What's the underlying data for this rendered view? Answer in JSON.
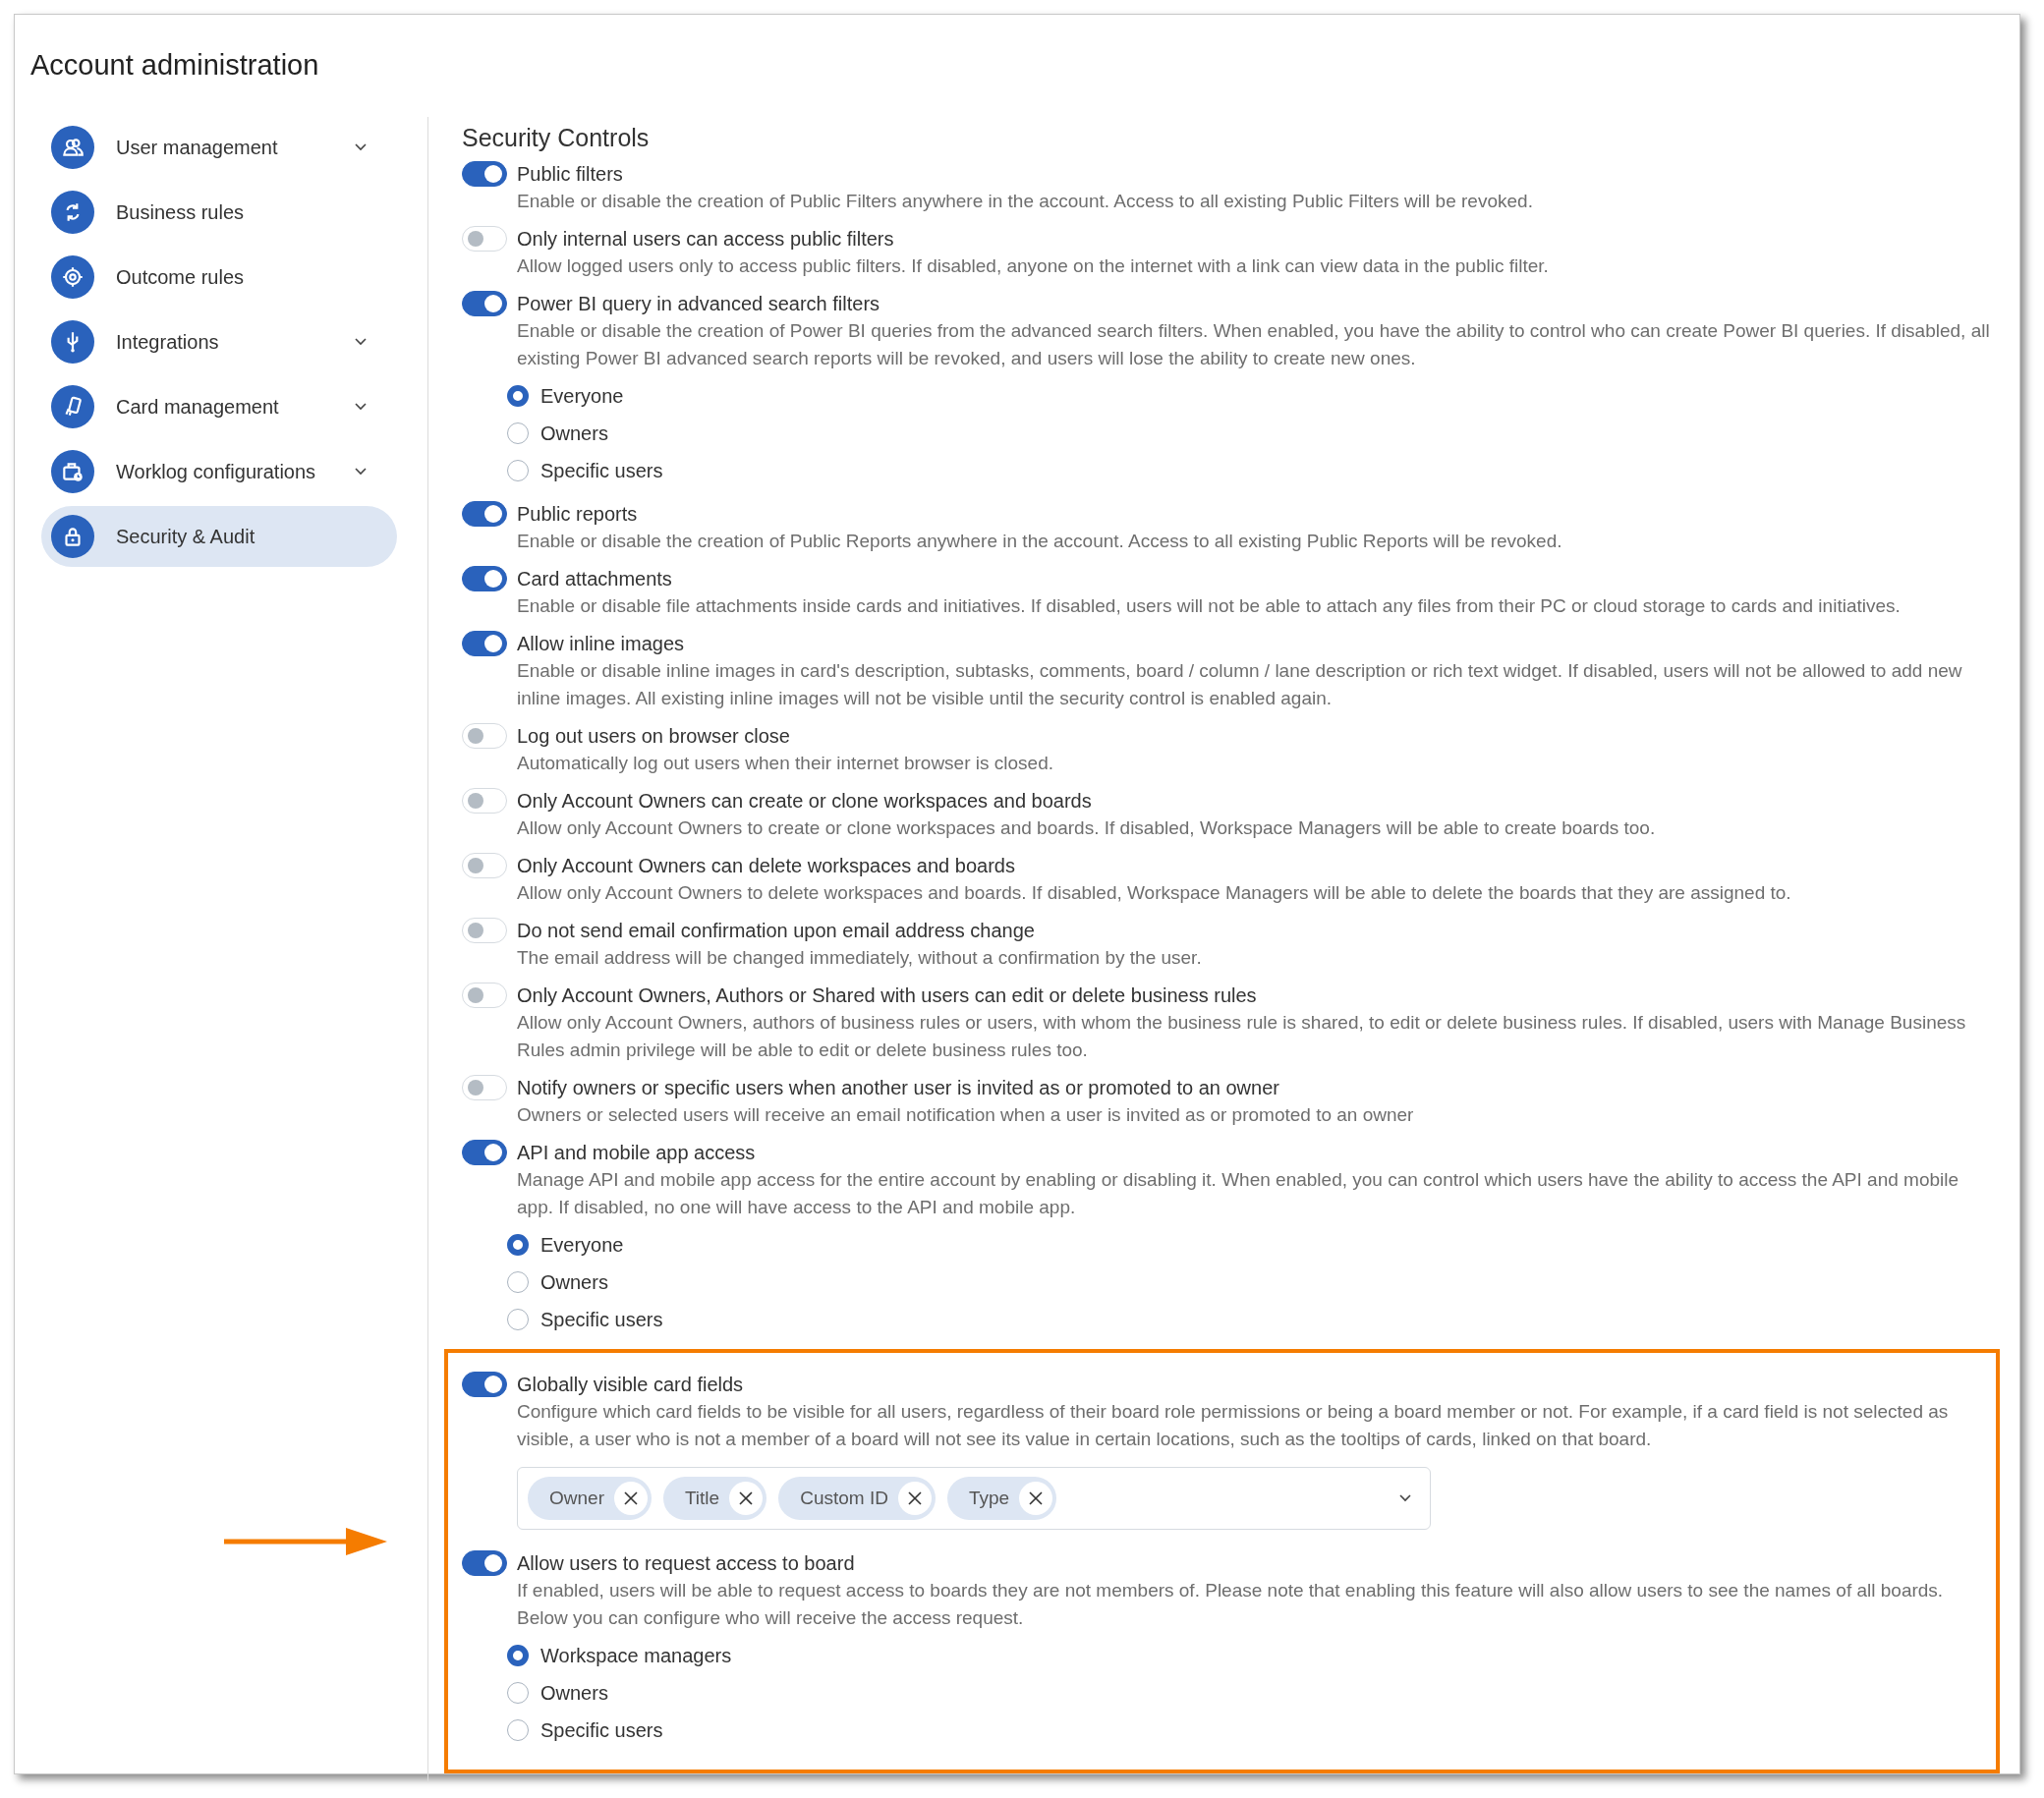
{
  "window": {
    "title": "Account administration"
  },
  "sidebar": {
    "items": [
      {
        "label": "User management",
        "expandable": true,
        "selected": false
      },
      {
        "label": "Business rules",
        "expandable": false,
        "selected": false
      },
      {
        "label": "Outcome rules",
        "expandable": false,
        "selected": false
      },
      {
        "label": "Integrations",
        "expandable": true,
        "selected": false
      },
      {
        "label": "Card management",
        "expandable": true,
        "selected": false
      },
      {
        "label": "Worklog configurations",
        "expandable": true,
        "selected": false
      },
      {
        "label": "Security & Audit",
        "expandable": false,
        "selected": true
      }
    ]
  },
  "content": {
    "heading": "Security Controls",
    "settings": [
      {
        "title": "Public filters",
        "on": true,
        "highlighted": false,
        "description": "Enable or disable the creation of Public Filters anywhere in the account. Access to all existing Public Filters will be revoked."
      },
      {
        "title": "Only internal users can access public filters",
        "on": false,
        "highlighted": false,
        "description": "Allow logged users only to access public filters. If disabled, anyone on the internet with a link can view data in the public filter."
      },
      {
        "title": "Power BI query in advanced search filters",
        "on": true,
        "highlighted": false,
        "description": "Enable or disable the creation of Power BI queries from the advanced search filters. When enabled, you have the ability to control who can create Power BI queries. If disabled, all existing Power BI advanced search reports will be revoked, and users will lose the ability to create new ones.",
        "options": [
          {
            "label": "Everyone",
            "selected": true
          },
          {
            "label": "Owners",
            "selected": false
          },
          {
            "label": "Specific users",
            "selected": false
          }
        ]
      },
      {
        "title": "Public reports",
        "on": true,
        "highlighted": false,
        "description": "Enable or disable the creation of Public Reports anywhere in the account. Access to all existing Public Reports will be revoked."
      },
      {
        "title": "Card attachments",
        "on": true,
        "highlighted": false,
        "description": "Enable or disable file attachments inside cards and initiatives. If disabled, users will not be able to attach any files from their PC or cloud storage to cards and initiatives."
      },
      {
        "title": "Allow inline images",
        "on": true,
        "highlighted": false,
        "description": "Enable or disable inline images in card's description, subtasks, comments, board / column / lane description or rich text widget. If disabled, users will not be allowed to add new inline images. All existing inline images will not be visible until the security control is enabled again."
      },
      {
        "title": "Log out users on browser close",
        "on": false,
        "highlighted": false,
        "description": "Automatically log out users when their internet browser is closed."
      },
      {
        "title": "Only Account Owners can create or clone workspaces and boards",
        "on": false,
        "highlighted": false,
        "description": "Allow only Account Owners to create or clone workspaces and boards. If disabled, Workspace Managers will be able to create boards too."
      },
      {
        "title": "Only Account Owners can delete workspaces and boards",
        "on": false,
        "highlighted": false,
        "description": "Allow only Account Owners to delete workspaces and boards. If disabled, Workspace Managers will be able to delete the boards that they are assigned to."
      },
      {
        "title": "Do not send email confirmation upon email address change",
        "on": false,
        "highlighted": false,
        "description": "The email address will be changed immediately, without a confirmation by the user."
      },
      {
        "title": "Only Account Owners, Authors or Shared with users can edit or delete business rules",
        "on": false,
        "highlighted": false,
        "description": "Allow only Account Owners, authors of business rules or users, with whom the business rule is shared, to edit or delete business rules. If disabled, users with Manage Business Rules admin privilege will be able to edit or delete business rules too."
      },
      {
        "title": "Notify owners or specific users when another user is invited as or promoted to an owner",
        "on": false,
        "highlighted": false,
        "description": "Owners or selected users will receive an email notification when a user is invited as or promoted to an owner"
      },
      {
        "title": "API and mobile app access",
        "on": true,
        "highlighted": false,
        "description": "Manage API and mobile app access for the entire account by enabling or disabling it. When enabled, you can control which users have the ability to access the API and mobile app. If disabled, no one will have access to the API and mobile app.",
        "options": [
          {
            "label": "Everyone",
            "selected": true
          },
          {
            "label": "Owners",
            "selected": false
          },
          {
            "label": "Specific users",
            "selected": false
          }
        ]
      },
      {
        "title": "Globally visible card fields",
        "on": true,
        "highlighted": true,
        "description": "Configure which card fields to be visible for all users, regardless of their board role permissions or being a board member or not. For example, if a card field is not selected as visible, a user who is not a member of a board will not see its value in certain locations, such as the tooltips of cards, linked on that board.",
        "tags": [
          {
            "label": "Owner"
          },
          {
            "label": "Title"
          },
          {
            "label": "Custom ID"
          },
          {
            "label": "Type"
          }
        ]
      },
      {
        "title": "Allow users to request access to board",
        "on": true,
        "highlighted": true,
        "description": "If enabled, users will be able to request access to boards they are not members of. Please note that enabling this feature will also allow users to see the names of all boards. Below you can configure who will receive the access request.",
        "options": [
          {
            "label": "Workspace managers",
            "selected": true
          },
          {
            "label": "Owners",
            "selected": false
          },
          {
            "label": "Specific users",
            "selected": false
          }
        ]
      }
    ]
  }
}
